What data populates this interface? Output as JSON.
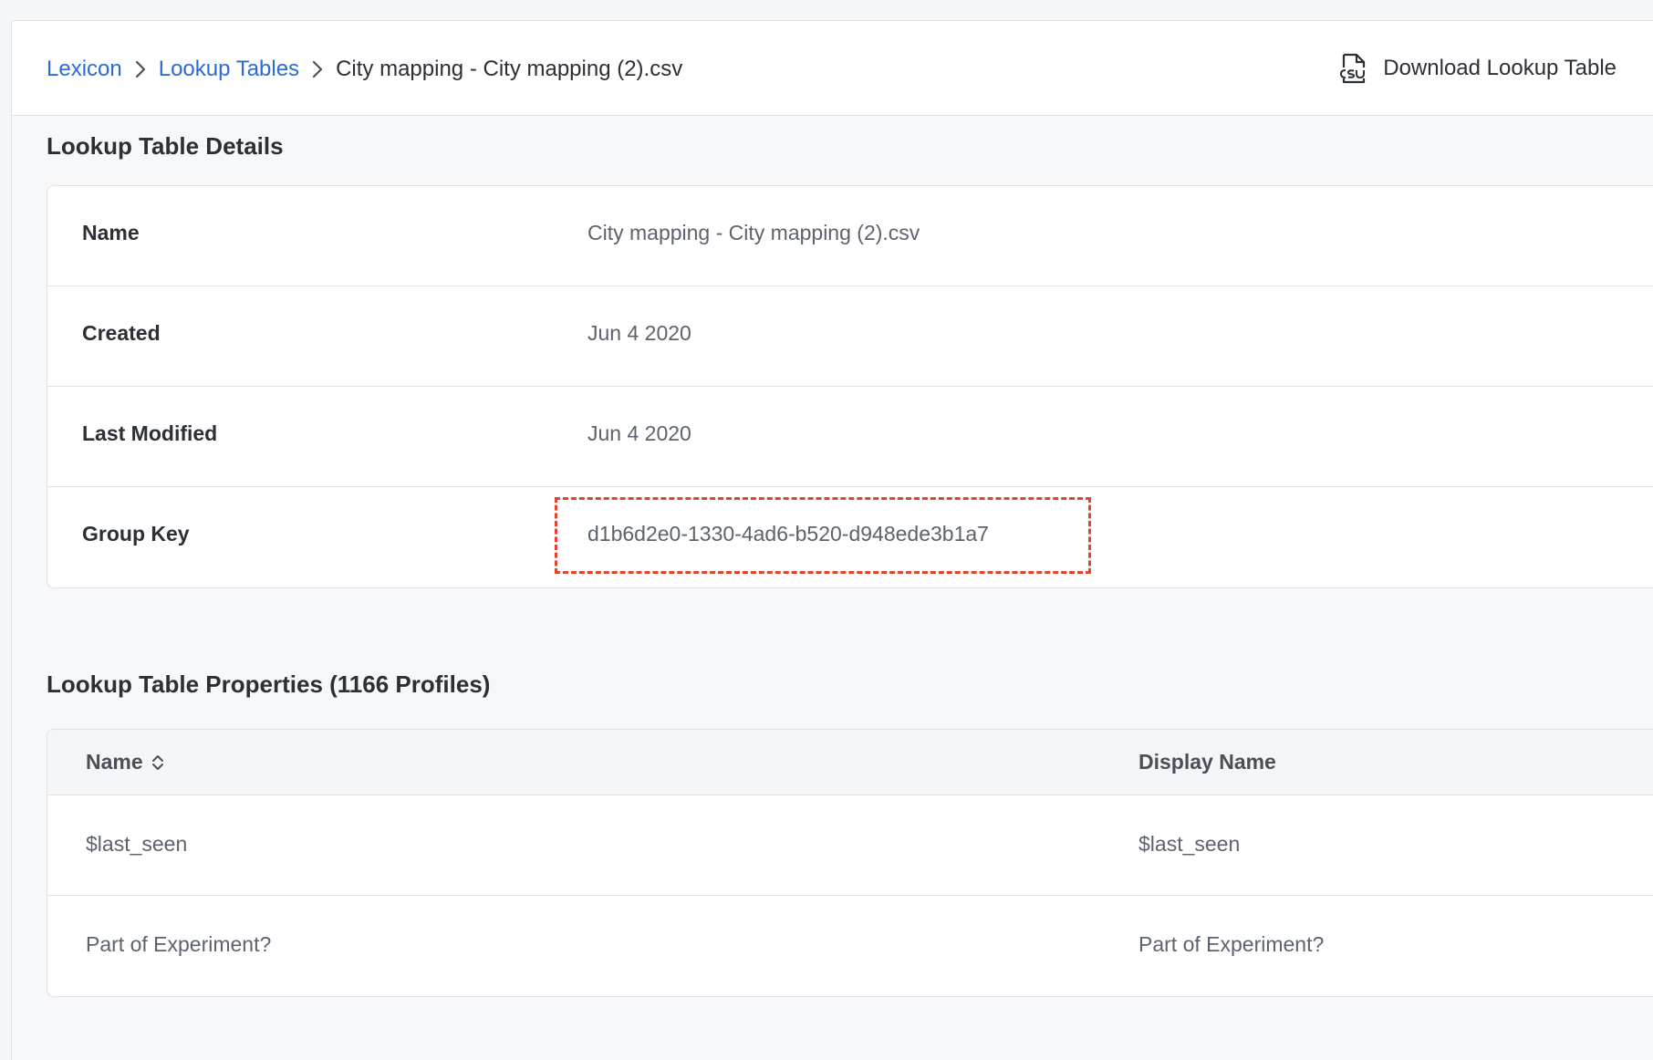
{
  "breadcrumb": {
    "items": [
      "Lexicon",
      "Lookup Tables"
    ],
    "current": "City mapping - City mapping (2).csv"
  },
  "header": {
    "download_label": "Download Lookup Table",
    "download_icon": "csv-file-icon"
  },
  "details": {
    "title": "Lookup Table Details",
    "rows": [
      {
        "label": "Name",
        "value": "City mapping - City mapping (2).csv"
      },
      {
        "label": "Created",
        "value": "Jun 4 2020"
      },
      {
        "label": "Last Modified",
        "value": "Jun 4 2020"
      },
      {
        "label": "Group Key",
        "value": "d1b6d2e0-1330-4ad6-b520-d948ede3b1a7"
      }
    ]
  },
  "properties": {
    "title": "Lookup Table Properties (1166 Profiles)",
    "columns": [
      "Name",
      "Display Name"
    ],
    "rows": [
      {
        "name": "$last_seen",
        "display_name": "$last_seen"
      },
      {
        "name": "Part of Experiment?",
        "display_name": "Part of Experiment?"
      }
    ]
  },
  "colors": {
    "link": "#2a6bd8",
    "highlight": "#e2452f"
  }
}
